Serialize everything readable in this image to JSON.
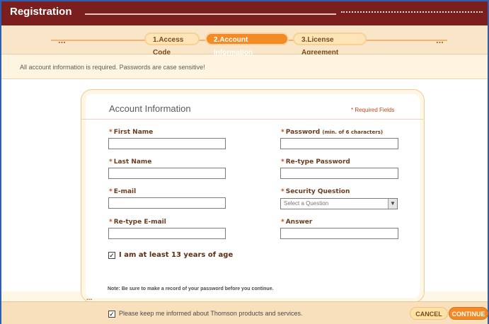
{
  "window": {
    "title": "Registration"
  },
  "steps": [
    {
      "label": "1.Access Code",
      "active": false
    },
    {
      "label": "2.Account Information",
      "active": true
    },
    {
      "label": "3.License Agreement",
      "active": false
    }
  ],
  "steps_ellipsis": "...",
  "info": {
    "text": "All account information is required. Passwords are case sensitive!"
  },
  "form": {
    "title": "Account Information",
    "required_note": "* Required Fields",
    "fields": {
      "first_name": {
        "label": "First Name",
        "value": ""
      },
      "last_name": {
        "label": "Last Name",
        "value": ""
      },
      "email": {
        "label": "E-mail",
        "value": ""
      },
      "retype_email": {
        "label": "Re-type E-mail",
        "value": ""
      },
      "password": {
        "label": "Password",
        "hint": "(min. of 6 characters)",
        "value": ""
      },
      "retype_password": {
        "label": "Re-type Password",
        "value": ""
      },
      "security_question": {
        "label": "Security Question",
        "selected": "Select a Question"
      },
      "answer": {
        "label": "Answer",
        "value": ""
      }
    },
    "age_checkbox": {
      "label": "I am at least 13 years of age",
      "checked": true
    },
    "note": "Note: Be sure to make a record of your password before you continue."
  },
  "footer": {
    "ellipsis": "...",
    "keep_informed": {
      "label": "Please keep me informed about Thomson products and services.",
      "checked": true
    },
    "cancel_label": "CANCEL",
    "continue_label": "CONTINUE"
  },
  "colors": {
    "titlebar": "#7b1e1e",
    "accent": "#f28a26",
    "required": "#c2461f"
  }
}
